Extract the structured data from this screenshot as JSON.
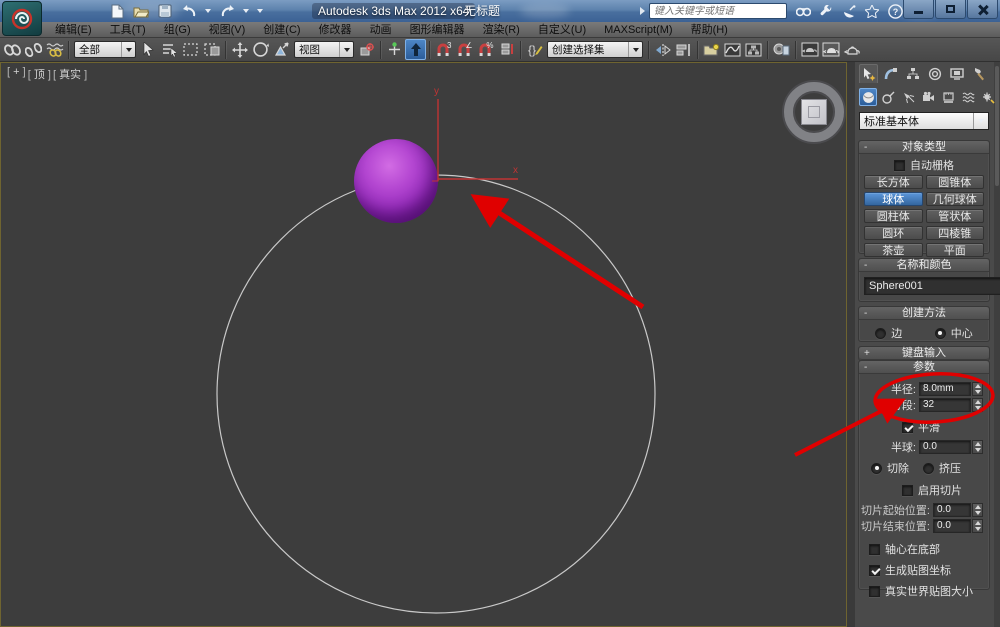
{
  "window": {
    "app_title": "Autodesk 3ds Max 2012 x64",
    "document_title": "无标题",
    "search_placeholder": "键入关键字或短语"
  },
  "menu": {
    "items": [
      "编辑(E)",
      "工具(T)",
      "组(G)",
      "视图(V)",
      "创建(C)",
      "修改器",
      "动画",
      "图形编辑器",
      "渲染(R)",
      "自定义(U)",
      "MAXScript(M)",
      "帮助(H)"
    ]
  },
  "toolbar": {
    "selection_filter_value": "全部",
    "coordinate_system_value": "视图",
    "named_selection_value": "创建选择集",
    "snap_mode": "3",
    "percent_label": "%",
    "angle_label": "∠"
  },
  "viewport": {
    "label_segments": [
      "+",
      "顶",
      "真实"
    ],
    "axis_x": "x",
    "axis_y": "y"
  },
  "command_panel": {
    "primitive_type_value": "标准基本体",
    "object_type": {
      "title": "对象类型",
      "state": "-",
      "autogrid_label": "自动栅格",
      "buttons": [
        "长方体",
        "圆锥体",
        "球体",
        "几何球体",
        "圆柱体",
        "管状体",
        "圆环",
        "四棱锥",
        "茶壶",
        "平面"
      ],
      "active_button": "球体"
    },
    "name_color": {
      "title": "名称和颜色",
      "state": "-",
      "name_value": "Sphere001",
      "color_hex": "#8a00a8"
    },
    "creation_method": {
      "title": "创建方法",
      "state": "-",
      "edge_label": "边",
      "center_label": "中心",
      "selected": "中心"
    },
    "keyboard_entry": {
      "title": "键盘输入",
      "state": "+"
    },
    "parameters": {
      "title": "参数",
      "state": "-",
      "radius_label": "半径:",
      "radius_value": "8.0mm",
      "segments_label": "分段:",
      "segments_value": "32",
      "smooth_label": "平滑",
      "smooth_checked": true,
      "hemisphere_label": "半球:",
      "hemisphere_value": "0.0",
      "chop_label": "切除",
      "squash_label": "挤压",
      "chop_selected": true,
      "enable_slice_label": "启用切片",
      "slice_from_label": "切片起始位置:",
      "slice_from_value": "0.0",
      "slice_to_label": "切片结束位置:",
      "slice_to_value": "0.0",
      "base_to_pivot_label": "轴心在底部",
      "gen_mapping_label": "生成贴图坐标",
      "gen_mapping_checked": true,
      "real_world_label": "真实世界贴图大小"
    }
  },
  "annotations": {
    "color": "#e00000"
  },
  "colors": {
    "accent_blue": "#3f7cc4",
    "sphere_purple": "#a238c8",
    "viewport_bg": "#3d3d3d",
    "circle_stroke": "#c8c8c8",
    "axis_red": "#c03434"
  }
}
